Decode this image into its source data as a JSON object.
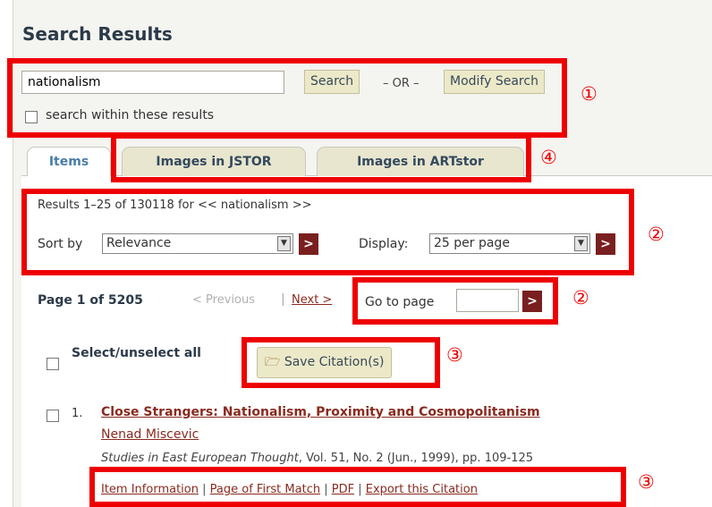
{
  "header": {
    "title": "Search Results"
  },
  "search": {
    "query_value": "nationalism",
    "search_button": "Search",
    "or_text": "– OR –",
    "modify_button": "Modify Search",
    "within_label": "search within these results"
  },
  "tabs": [
    {
      "label": "Items",
      "active": true
    },
    {
      "label": "Images in JSTOR",
      "active": false
    },
    {
      "label": "Images in ARTstor",
      "active": false
    }
  ],
  "results": {
    "summary": "Results 1–25 of 130118 for << nationalism >>",
    "sort_label": "Sort by",
    "sort_value": "Relevance",
    "display_label": "Display:",
    "display_value": "25 per page",
    "go_glyph": ">"
  },
  "pagination": {
    "page_info": "Page 1 of 5205",
    "previous": "< Previous",
    "divider": "|",
    "next": "Next >",
    "goto_label": "Go to page",
    "goto_value": ""
  },
  "selection": {
    "select_all_label": "Select/unselect all",
    "save_button": "Save Citation(s)"
  },
  "items": [
    {
      "number": "1.",
      "title": "Close Strangers: Nationalism, Proximity and Cosmopolitanism",
      "author": "Nenad Miscevic",
      "journal": "Studies in East European Thought",
      "details": ", Vol. 51, No. 2 (Jun., 1999), pp. 109-125",
      "links": [
        "Item Information",
        "Page of First Match",
        "PDF",
        "Export this Citation"
      ]
    }
  ],
  "annotations": {
    "n1": "①",
    "n2": "②",
    "n3": "③",
    "n4": "④"
  },
  "colors": {
    "highlight": "#ee0000",
    "go_button": "#7a1f1f",
    "link": "#8a2a1f"
  },
  "icons": {
    "save": "folder-save-icon",
    "dropdown": "chevron-down-icon"
  }
}
